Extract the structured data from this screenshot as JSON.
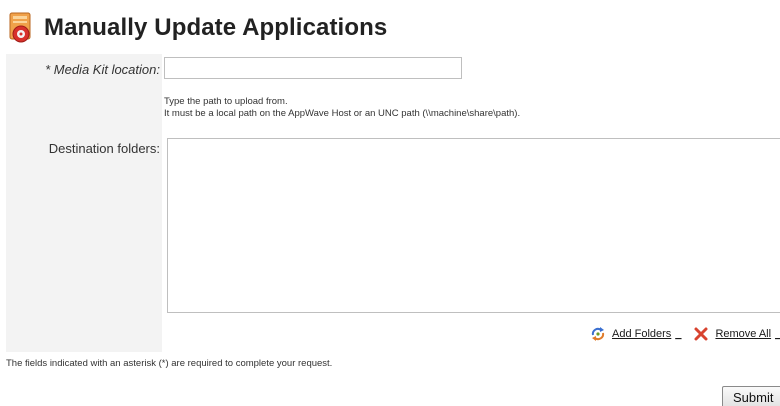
{
  "header": {
    "title": "Manually Update Applications",
    "icon": "app-update-icon"
  },
  "form": {
    "media_kit": {
      "required_marker": "*",
      "label": "Media Kit location:",
      "value": "",
      "placeholder": ""
    },
    "help_text": {
      "line1": "Type the path to upload from.",
      "line2": "It must be a local path on the AppWave Host or an UNC path (\\\\machine\\share\\path)."
    },
    "destination": {
      "label": "Destination folders:",
      "items": []
    },
    "actions": {
      "add_folders": "Add Folders",
      "remove_all": "Remove All",
      "separator": "_"
    },
    "footnote": "The fields indicated with an asterisk (*) are required to complete your request.",
    "submit_label": "Submit"
  },
  "colors": {
    "label_column_bg": "#f3f3f3",
    "remove_icon": "#d8432f",
    "icon_orange": "#e07b2a"
  }
}
